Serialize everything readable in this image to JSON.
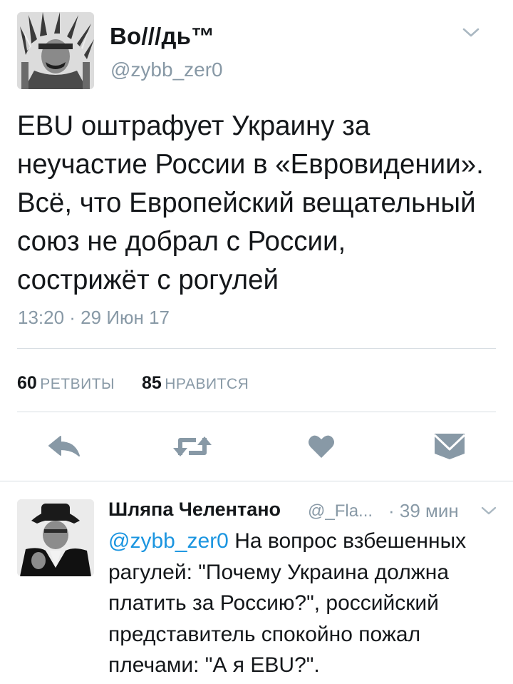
{
  "tweet": {
    "author_name": "Во///дь™",
    "author_handle": "@zybb_zer0",
    "text": "EBU оштрафует Украину за\nнеучастие России в «Евровидении».\nВсё, что Европейский вещательный\nсоюз не добрал с России,\nсострижёт с рогулей",
    "timestamp": "13:20 · 29 Июн 17",
    "retweet_count": "60",
    "retweet_label": "РЕТВИТЫ",
    "like_count": "85",
    "like_label": "НРАВИТСЯ"
  },
  "actions": {
    "icons": [
      "reply-icon",
      "retweet-icon",
      "heart-icon",
      "envelope-icon"
    ],
    "icon_color": "#8899a6"
  },
  "reply": {
    "author_name": "Шляпа Челентано",
    "author_handle": "@_Fla...",
    "time": "· 39 мин",
    "mention": "@zybb_zer0",
    "text": " На вопрос взбешенных рагулей: \"Почему Украина должна платить за Россию?\", российский представитель спокойно пожал плечами: \"А я EBU?\"."
  },
  "colors": {
    "text": "#14171a",
    "secondary": "#8899a6",
    "link": "#1b95e0",
    "divider": "#d7dde2"
  }
}
